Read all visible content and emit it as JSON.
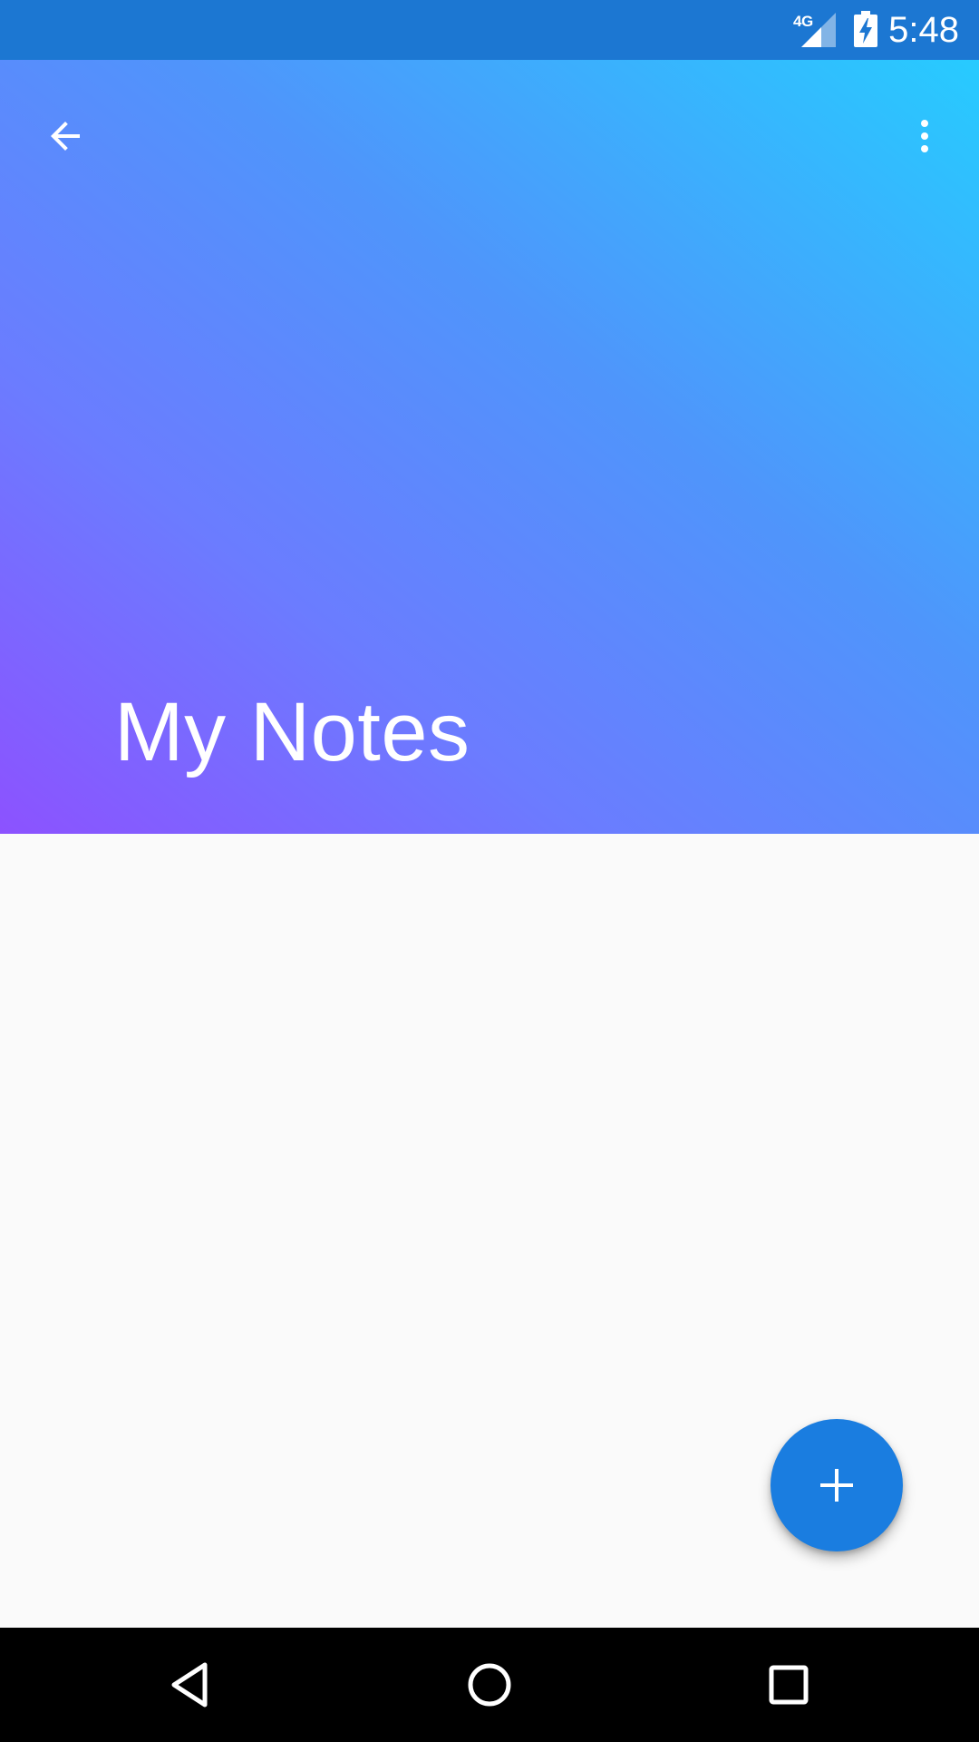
{
  "status_bar": {
    "network_label": "4G",
    "time": "5:48",
    "icons": [
      "signal-icon",
      "battery-charging-icon"
    ],
    "background_color": "#1c77d2"
  },
  "toolbar": {
    "back_icon": "arrow-left-icon",
    "overflow_icon": "more-vert-icon"
  },
  "header": {
    "title": "My Notes",
    "gradient_colors": [
      "#8c52ff",
      "#6b7cff",
      "#4f95fb",
      "#27cbff"
    ]
  },
  "fab": {
    "icon": "plus-icon",
    "color": "#1a7de0"
  },
  "nav_bar": {
    "icons": [
      "nav-back-icon",
      "nav-home-icon",
      "nav-recents-icon"
    ]
  }
}
